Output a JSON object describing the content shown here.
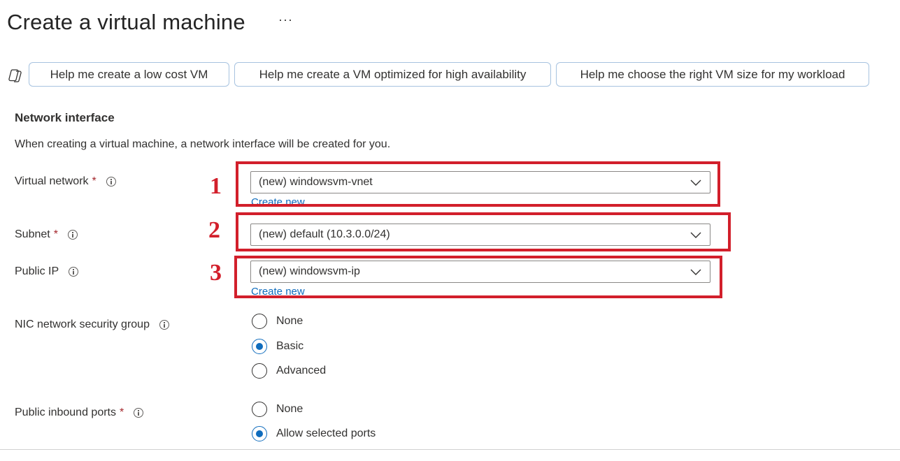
{
  "page": {
    "title": "Create a virtual machine",
    "more_label": "···"
  },
  "copilot": {
    "suggestions": [
      "Help me create a low cost VM",
      "Help me create a VM optimized for high availability",
      "Help me choose the right VM size for my workload"
    ]
  },
  "network_interface": {
    "section_title": "Network interface",
    "description": "When creating a virtual machine, a network interface will be created for you.",
    "virtual_network": {
      "label": "Virtual network",
      "required": "*",
      "value": "(new) windowsvm-vnet",
      "create_new": "Create new"
    },
    "subnet": {
      "label": "Subnet",
      "required": "*",
      "value": "(new) default (10.3.0.0/24)"
    },
    "public_ip": {
      "label": "Public IP",
      "value": "(new) windowsvm-ip",
      "create_new": "Create new"
    },
    "nic_nsg": {
      "label": "NIC network security group",
      "options": [
        "None",
        "Basic",
        "Advanced"
      ],
      "selected": "Basic"
    },
    "public_inbound_ports": {
      "label": "Public inbound ports",
      "required": "*",
      "options": [
        "None",
        "Allow selected ports"
      ],
      "selected": "Allow selected ports"
    }
  },
  "annotations": {
    "marker_1": "1",
    "marker_2": "2",
    "marker_3": "3"
  },
  "colors": {
    "accent": "#0f6cbd",
    "annotation_red": "#d21f2b",
    "required_red": "#a4262c"
  }
}
